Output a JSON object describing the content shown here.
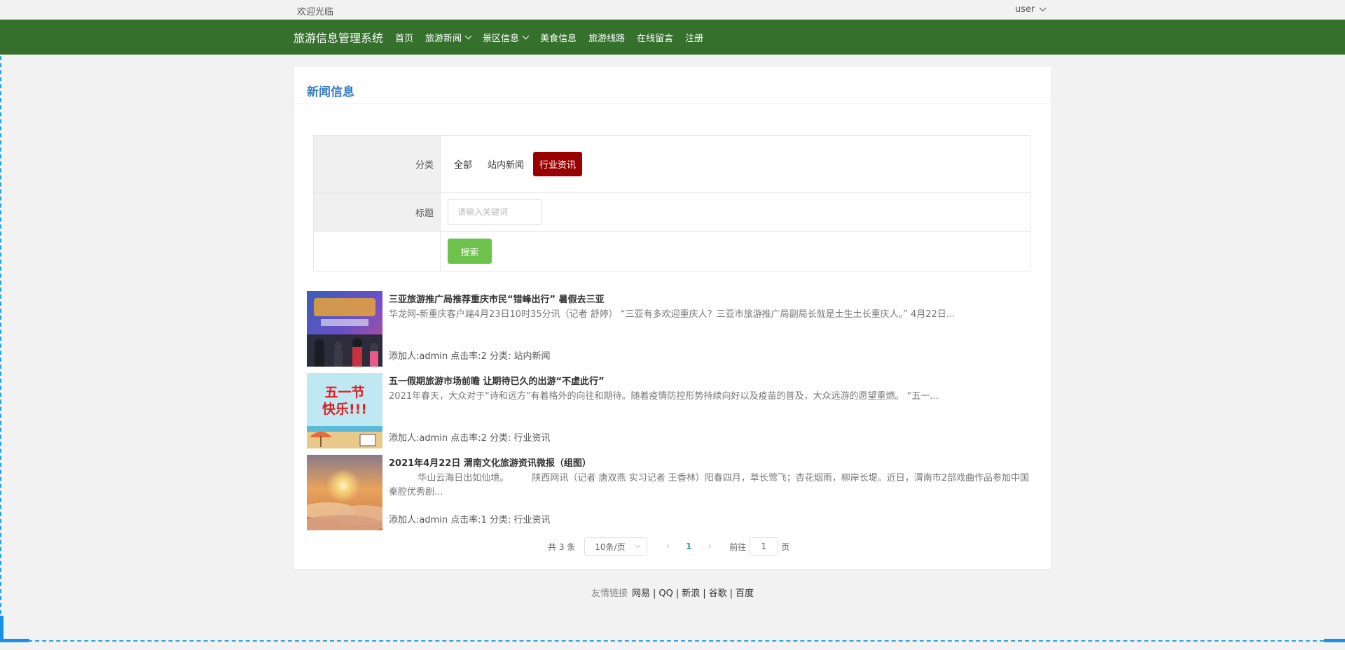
{
  "topbar": {
    "welcome": "欢迎光临",
    "user": "user"
  },
  "nav": {
    "brand": "旅游信息管理系统",
    "items": [
      {
        "label": "首页",
        "dropdown": false
      },
      {
        "label": "旅游新闻",
        "dropdown": true
      },
      {
        "label": "景区信息",
        "dropdown": true
      },
      {
        "label": "美食信息",
        "dropdown": false
      },
      {
        "label": "旅游线路",
        "dropdown": false
      },
      {
        "label": "在线留言",
        "dropdown": false
      },
      {
        "label": "注册",
        "dropdown": false
      }
    ]
  },
  "card": {
    "title": "新闻信息"
  },
  "filter": {
    "category_label": "分类",
    "categories": [
      "全部",
      "站内新闻",
      "行业资讯"
    ],
    "active_category": "行业资讯",
    "title_label": "标题",
    "keyword_placeholder": "请输入关键词",
    "search_button": "搜索"
  },
  "news": [
    {
      "title": "三亚旅游推广局推荐重庆市民“错峰出行” 暑假去三亚",
      "summary": "华龙网-新重庆客户端4月23日10时35分讯（记者 舒婷） “三亚有多欢迎重庆人？三亚市旅游推广局副局长就是土生土长重庆人。” 4月22日...",
      "meta": "添加人:admin  点击率:2  分类: 站内新闻",
      "thumb_colors": [
        "#3a5fb8",
        "#c94f8c",
        "#e8a33a"
      ]
    },
    {
      "title": "五一假期旅游市场前瞻 让期待已久的出游“不虚此行”",
      "summary": "2021年春天，大众对于“诗和远方”有着格外的向往和期待。随着疫情防控形势持续向好以及疫苗的普及，大众远游的愿望重燃。 “五一...",
      "meta": "添加人:admin  点击率:2  分类: 行业资讯",
      "thumb_text": "五一节 快乐!!!",
      "thumb_colors": [
        "#bfe8f3",
        "#e02020",
        "#e8c98a"
      ]
    },
    {
      "title": "2021年4月22日 渭南文化旅游资讯微报（组图）",
      "summary": "          华山云海日出如仙境。        陕西网讯（记者 唐双燕 实习记者 王香林）阳春四月，草长莺飞；杏花烟雨，柳岸长堤。近日，渭南市2部戏曲作品参加中国秦腔优秀剧...",
      "meta": "添加人:admin  点击率:1  分类: 行业资讯",
      "thumb_colors": [
        "#e8a35c",
        "#f5d27a",
        "#8a6a5c"
      ]
    }
  ],
  "pager": {
    "total": "共 3 条",
    "page_size": "10条/页",
    "prev": "‹",
    "current": "1",
    "next": "›",
    "goto_prefix": "前往",
    "goto_value": "1",
    "goto_suffix": "页"
  },
  "footer": {
    "label": "友情链接",
    "links": [
      "网易",
      "QQ",
      "新浪",
      "谷歌",
      "百度"
    ]
  }
}
